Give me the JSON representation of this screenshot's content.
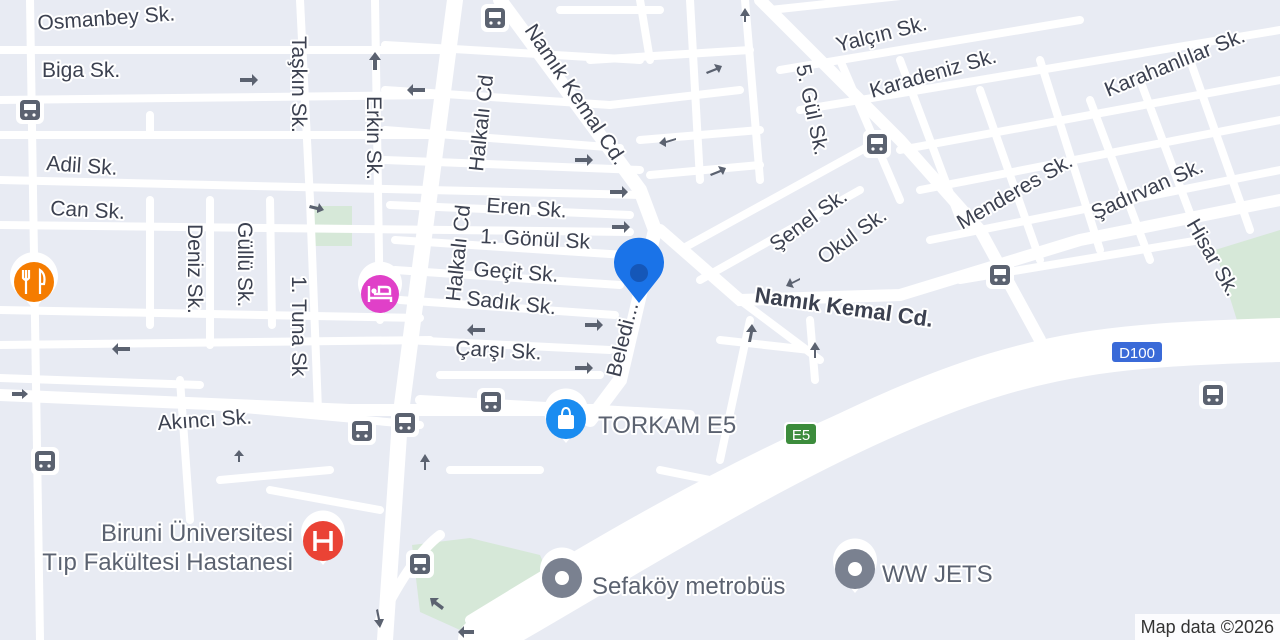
{
  "streets": {
    "osmanbey": "Osmanbey Sk.",
    "biga": "Biga Sk.",
    "adil": "Adil Sk.",
    "can": "Can Sk.",
    "taskin": "Taşkın Sk.",
    "erkin": "Erkin Sk.",
    "halkali_cd_1": "Halkalı Cd",
    "halkali_cd_2": "Halkalı Cd",
    "namik_kemal_cd_1": "Namık Kemal Cd.",
    "namik_kemal_cd_2": "Namık Kemal Cd.",
    "eren": "Eren Sk.",
    "gonul": "1. Gönül Sk",
    "gecit": "Geçit Sk.",
    "sadik": "Sadık Sk.",
    "carsi": "Çarşı Sk.",
    "belediye": "Beledi... .",
    "deniz": "Deniz Sk.",
    "gullu": "Güllü Sk.",
    "tuna": "1. Tuna Sk",
    "akinci": "Akıncı Sk.",
    "yalcin": "Yalçın Sk.",
    "karadeniz": "Karadeniz Sk.",
    "gul5": "5. Gül Sk.",
    "karahanlilar": "Karahanlılar Sk.",
    "senel": "Şenel Sk.",
    "okul": "Okul Sk.",
    "menderes": "Menderes Sk.",
    "sadirvan": "Şadırvan Sk.",
    "hisar": "Hisar Sk."
  },
  "pois": {
    "torkam": "TORKAM E5",
    "biruni_line1": "Biruni Üniversitesi",
    "biruni_line2": "Tıp Fakültesi Hastanesi",
    "sefakoy": "Sefaköy metrobüs",
    "wwjets": "WW JETS"
  },
  "shields": {
    "d100": "D100",
    "e5": "E5"
  },
  "attribution": "Map data ©2026",
  "colors": {
    "background": "#e8ebf3",
    "road": "#ffffff",
    "park": "#d6e8d8",
    "pin": "#1a73e8",
    "hospital": "#ea4335",
    "hotel": "#e040c8",
    "restaurant": "#f57c00",
    "shopping": "#1a8cf0",
    "generic_poi": "#7a8190",
    "transit": "#5b6270",
    "d100_shield": "#3a6ad8",
    "e5_shield": "#3c8c3c"
  },
  "icons": [
    "bus-stop-icon",
    "hospital-icon",
    "hotel-icon",
    "restaurant-icon",
    "shopping-bag-icon",
    "place-icon",
    "location-pin-icon",
    "one-way-arrow-icon"
  ]
}
